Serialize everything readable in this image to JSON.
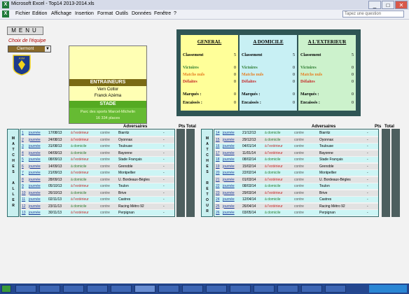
{
  "window": {
    "title": "Microsoft Excel - Top14 2013-2014.xls",
    "btn_min": "_",
    "btn_max": "□",
    "btn_close": "✕"
  },
  "menubar": {
    "items": [
      "Fichier",
      "Edition",
      "Affichage",
      "Insertion",
      "Format",
      "Outils",
      "Données",
      "Fenêtre",
      "?"
    ],
    "question_placeholder": "Tapez une question"
  },
  "left": {
    "menu_label": "MENU",
    "choose_team": "Choix de l'équipe",
    "selected_team": "Clermont",
    "logo_text": "ASM"
  },
  "info": {
    "coaches_label": "ENTRAINEURS",
    "coaches": [
      "Vern Cottor",
      "Franck Azéma"
    ],
    "stadium_label": "STADE",
    "stadium_name": "Parc des sports Marcel-Michelin",
    "capacity": "16 334 places"
  },
  "stats": {
    "columns": [
      {
        "title": "GENERAL",
        "bg": "#ffff99",
        "rows": [
          [
            "Classement",
            "5"
          ],
          [
            "Victoires",
            "0"
          ],
          [
            "Matchs nuls",
            "0"
          ],
          [
            "Défaites",
            "0"
          ],
          [
            "Marqués :",
            "0"
          ],
          [
            "Encaissés :",
            "0"
          ]
        ]
      },
      {
        "title": "A DOMICILE",
        "bg": "#c8f0f4",
        "rows": [
          [
            "Classement",
            "5"
          ],
          [
            "Victoires",
            "0"
          ],
          [
            "Matchs nuls",
            "0"
          ],
          [
            "Défaites",
            "0"
          ],
          [
            "Marqués :",
            "0"
          ],
          [
            "Encaissés :",
            "0"
          ]
        ]
      },
      {
        "title": "A L'EXTERIEUR",
        "bg": "#ccf2cc",
        "rows": [
          [
            "Classement",
            "5"
          ],
          [
            "Victoires",
            "0"
          ],
          [
            "Matchs nuls",
            "0"
          ],
          [
            "Défaites",
            "0"
          ],
          [
            "Marqués :",
            "0"
          ],
          [
            "Encaissés :",
            "0"
          ]
        ]
      }
    ],
    "row_colors": [
      "#000000",
      "#2e7d32",
      "#e67e22",
      "#c62828",
      "#000000",
      "#000000"
    ]
  },
  "aller": {
    "side_label": [
      "M",
      "A",
      "T",
      "C",
      "H",
      "E",
      "S",
      "",
      "A",
      "L",
      "L",
      "E",
      "R"
    ],
    "headers": {
      "opponents": "Adversaires",
      "pts": "Pts",
      "total": "Total"
    },
    "rows": [
      [
        "1",
        "journée",
        "17/08/13",
        "à l'extérieur",
        "contre",
        "Biarritz",
        "-"
      ],
      [
        "2",
        "journée",
        "24/08/13",
        "à l'extérieur",
        "contre",
        "Oyonnax",
        "-"
      ],
      [
        "3",
        "journée",
        "31/08/13",
        "à domicile",
        "contre",
        "Toulouse",
        "-"
      ],
      [
        "4",
        "journée",
        "04/09/13",
        "à domicile",
        "contre",
        "Bayonne",
        "-"
      ],
      [
        "5",
        "journée",
        "08/09/13",
        "à l'extérieur",
        "contre",
        "Stade Français",
        "-"
      ],
      [
        "6",
        "journée",
        "14/09/13",
        "à domicile",
        "contre",
        "Grenoble",
        "-"
      ],
      [
        "7",
        "journée",
        "21/09/13",
        "à l'extérieur",
        "contre",
        "Montpellier",
        "-"
      ],
      [
        "8",
        "journée",
        "28/09/13",
        "à domicile",
        "contre",
        "U. Bordeaux-Bègles",
        "-"
      ],
      [
        "9",
        "journée",
        "05/10/13",
        "à l'extérieur",
        "contre",
        "Toulon",
        "-"
      ],
      [
        "10",
        "journée",
        "26/10/13",
        "à domicile",
        "contre",
        "Brive",
        "-"
      ],
      [
        "11",
        "journée",
        "02/11/13",
        "à l'extérieur",
        "contre",
        "Castres",
        "-"
      ],
      [
        "12",
        "journée",
        "23/11/13",
        "à domicile",
        "contre",
        "Racing Métro 92",
        "-"
      ],
      [
        "13",
        "journée",
        "30/11/13",
        "à l'extérieur",
        "contre",
        "Perpignan",
        "-"
      ]
    ]
  },
  "retour": {
    "side_label": [
      "M",
      "A",
      "T",
      "C",
      "H",
      "E",
      "S",
      "",
      "R",
      "E",
      "T",
      "O",
      "U",
      "R"
    ],
    "headers": {
      "opponents": "Adversaires",
      "pts": "Pts",
      "total": "Total"
    },
    "rows": [
      [
        "14",
        "journée",
        "21/12/13",
        "à domicile",
        "contre",
        "Biarritz",
        "-"
      ],
      [
        "15",
        "journée",
        "29/12/13",
        "à domicile",
        "contre",
        "Oyonnax",
        "-"
      ],
      [
        "16",
        "journée",
        "04/01/14",
        "à l'extérieur",
        "contre",
        "Toulouse",
        "-"
      ],
      [
        "17",
        "journée",
        "11/01/14",
        "à l'extérieur",
        "contre",
        "Bayonne",
        "-"
      ],
      [
        "18",
        "journée",
        "08/02/14",
        "à domicile",
        "contre",
        "Stade Français",
        "-"
      ],
      [
        "19",
        "journée",
        "15/02/14",
        "à l'extérieur",
        "contre",
        "Grenoble",
        "-"
      ],
      [
        "20",
        "journée",
        "22/02/14",
        "à domicile",
        "contre",
        "Montpellier",
        "-"
      ],
      [
        "21",
        "journée",
        "01/03/14",
        "à l'extérieur",
        "contre",
        "U. Bordeaux-Bègles",
        "-"
      ],
      [
        "22",
        "journée",
        "08/03/14",
        "à domicile",
        "contre",
        "Toulon",
        "-"
      ],
      [
        "23",
        "journée",
        "29/03/14",
        "à l'extérieur",
        "contre",
        "Brive",
        "-"
      ],
      [
        "24",
        "journée",
        "12/04/14",
        "à domicile",
        "contre",
        "Castres",
        "-"
      ],
      [
        "25",
        "journée",
        "26/04/14",
        "à l'extérieur",
        "contre",
        "Racing Métro 92",
        "-"
      ],
      [
        "26",
        "journée",
        "03/05/14",
        "à domicile",
        "contre",
        "Perpignan",
        "-"
      ]
    ]
  },
  "row_bg": [
    "#ccf5f5",
    "#e2e2e2"
  ]
}
